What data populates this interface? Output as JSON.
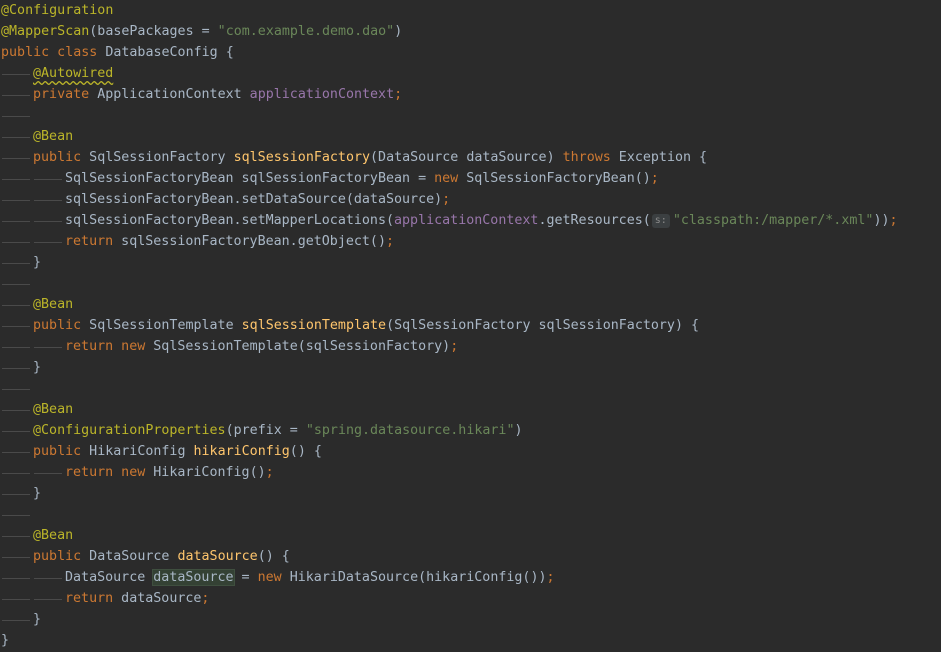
{
  "theme": {
    "background": "#2b2b2b",
    "plain": "#a9b7c6",
    "keyword": "#cc7832",
    "annotation": "#bbb529",
    "string": "#6a8759",
    "field": "#9876aa",
    "method_decl": "#ffc66d",
    "indent_guide": "#4a4a4a"
  },
  "code": {
    "lines": [
      {
        "indent": 0,
        "tokens": [
          {
            "t": "@Configuration",
            "k": "annotation"
          }
        ]
      },
      {
        "indent": 0,
        "tokens": [
          {
            "t": "@MapperScan",
            "k": "annotation"
          },
          {
            "t": "(basePackages = ",
            "k": "plain"
          },
          {
            "t": "\"com.example.demo.dao\"",
            "k": "string"
          },
          {
            "t": ")",
            "k": "plain"
          }
        ]
      },
      {
        "indent": 0,
        "tokens": [
          {
            "t": "public class ",
            "k": "keyword"
          },
          {
            "t": "DatabaseConfig {",
            "k": "plain"
          }
        ]
      },
      {
        "indent": 1,
        "tokens": [
          {
            "t": "@Autowired",
            "k": "annotation",
            "squiggle": true
          }
        ]
      },
      {
        "indent": 1,
        "tokens": [
          {
            "t": "private ",
            "k": "keyword"
          },
          {
            "t": "ApplicationContext ",
            "k": "plain"
          },
          {
            "t": "applicationContext",
            "k": "field"
          },
          {
            "t": ";",
            "k": "keyword"
          }
        ]
      },
      {
        "indent": 1,
        "tokens": []
      },
      {
        "indent": 1,
        "tokens": [
          {
            "t": "@Bean",
            "k": "annotation"
          }
        ]
      },
      {
        "indent": 1,
        "tokens": [
          {
            "t": "public ",
            "k": "keyword"
          },
          {
            "t": "SqlSessionFactory ",
            "k": "plain"
          },
          {
            "t": "sqlSessionFactory",
            "k": "method_decl"
          },
          {
            "t": "(DataSource dataSource) ",
            "k": "plain"
          },
          {
            "t": "throws ",
            "k": "keyword"
          },
          {
            "t": "Exception {",
            "k": "plain"
          }
        ]
      },
      {
        "indent": 2,
        "tokens": [
          {
            "t": "SqlSessionFactoryBean sqlSessionFactoryBean = ",
            "k": "plain"
          },
          {
            "t": "new ",
            "k": "keyword"
          },
          {
            "t": "SqlSessionFactoryBean()",
            "k": "plain"
          },
          {
            "t": ";",
            "k": "keyword"
          }
        ]
      },
      {
        "indent": 2,
        "tokens": [
          {
            "t": "sqlSessionFactoryBean.setDataSource(dataSource)",
            "k": "plain"
          },
          {
            "t": ";",
            "k": "keyword"
          }
        ]
      },
      {
        "indent": 2,
        "tokens": [
          {
            "t": "sqlSessionFactoryBean.setMapperLocations(",
            "k": "plain"
          },
          {
            "t": "applicationContext",
            "k": "field"
          },
          {
            "t": ".getResources(",
            "k": "plain"
          },
          {
            "t": "s:",
            "k": "hint"
          },
          {
            "t": "\"classpath:/mapper/*.xml\"",
            "k": "string"
          },
          {
            "t": "))",
            "k": "plain"
          },
          {
            "t": ";",
            "k": "keyword"
          }
        ]
      },
      {
        "indent": 2,
        "tokens": [
          {
            "t": "return ",
            "k": "keyword"
          },
          {
            "t": "sqlSessionFactoryBean.getObject()",
            "k": "plain"
          },
          {
            "t": ";",
            "k": "keyword"
          }
        ]
      },
      {
        "indent": 1,
        "tokens": [
          {
            "t": "}",
            "k": "plain"
          }
        ]
      },
      {
        "indent": 1,
        "tokens": []
      },
      {
        "indent": 1,
        "tokens": [
          {
            "t": "@Bean",
            "k": "annotation"
          }
        ]
      },
      {
        "indent": 1,
        "tokens": [
          {
            "t": "public ",
            "k": "keyword"
          },
          {
            "t": "SqlSessionTemplate ",
            "k": "plain"
          },
          {
            "t": "sqlSessionTemplate",
            "k": "method_decl"
          },
          {
            "t": "(SqlSessionFactory sqlSessionFactory) {",
            "k": "plain"
          }
        ]
      },
      {
        "indent": 2,
        "tokens": [
          {
            "t": "return new ",
            "k": "keyword"
          },
          {
            "t": "SqlSessionTemplate(sqlSessionFactory)",
            "k": "plain"
          },
          {
            "t": ";",
            "k": "keyword"
          }
        ]
      },
      {
        "indent": 1,
        "tokens": [
          {
            "t": "}",
            "k": "plain"
          }
        ]
      },
      {
        "indent": 1,
        "tokens": []
      },
      {
        "indent": 1,
        "tokens": [
          {
            "t": "@Bean",
            "k": "annotation"
          }
        ]
      },
      {
        "indent": 1,
        "tokens": [
          {
            "t": "@ConfigurationProperties",
            "k": "annotation"
          },
          {
            "t": "(prefix = ",
            "k": "plain"
          },
          {
            "t": "\"spring.datasource.hikari\"",
            "k": "string"
          },
          {
            "t": ")",
            "k": "plain"
          }
        ]
      },
      {
        "indent": 1,
        "tokens": [
          {
            "t": "public ",
            "k": "keyword"
          },
          {
            "t": "HikariConfig ",
            "k": "plain"
          },
          {
            "t": "hikariConfig",
            "k": "method_decl"
          },
          {
            "t": "() {",
            "k": "plain"
          }
        ]
      },
      {
        "indent": 2,
        "tokens": [
          {
            "t": "return new ",
            "k": "keyword"
          },
          {
            "t": "HikariConfig()",
            "k": "plain"
          },
          {
            "t": ";",
            "k": "keyword"
          }
        ]
      },
      {
        "indent": 1,
        "tokens": [
          {
            "t": "}",
            "k": "plain"
          }
        ]
      },
      {
        "indent": 1,
        "tokens": []
      },
      {
        "indent": 1,
        "tokens": [
          {
            "t": "@Bean",
            "k": "annotation"
          }
        ]
      },
      {
        "indent": 1,
        "tokens": [
          {
            "t": "public ",
            "k": "keyword"
          },
          {
            "t": "DataSource ",
            "k": "plain"
          },
          {
            "t": "dataSource",
            "k": "method_decl"
          },
          {
            "t": "() {",
            "k": "plain"
          }
        ]
      },
      {
        "indent": 2,
        "tokens": [
          {
            "t": "DataSource ",
            "k": "plain"
          },
          {
            "t": "dataSource",
            "k": "plain",
            "highlight": true
          },
          {
            "t": " = ",
            "k": "plain"
          },
          {
            "t": "new ",
            "k": "keyword"
          },
          {
            "t": "HikariDataSource(hikariConfig())",
            "k": "plain"
          },
          {
            "t": ";",
            "k": "keyword"
          }
        ]
      },
      {
        "indent": 2,
        "tokens": [
          {
            "t": "return ",
            "k": "keyword"
          },
          {
            "t": "dataSource",
            "k": "plain"
          },
          {
            "t": ";",
            "k": "keyword"
          }
        ]
      },
      {
        "indent": 1,
        "tokens": [
          {
            "t": "}",
            "k": "plain"
          }
        ]
      },
      {
        "indent": 0,
        "tokens": [
          {
            "t": "}",
            "k": "plain"
          }
        ]
      }
    ]
  }
}
